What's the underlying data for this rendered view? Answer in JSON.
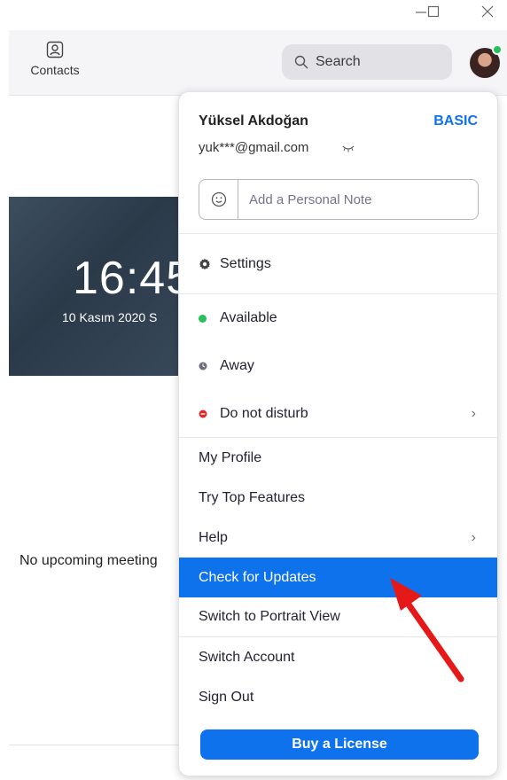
{
  "window": {
    "minimize_glyph": "—",
    "maximize_glyph": "☐",
    "close_glyph": "✕"
  },
  "toolbar": {
    "contacts_label": "Contacts",
    "search_label": "Search",
    "presence_color": "#26c15a"
  },
  "background": {
    "clock_time": "16:45",
    "clock_date": "10 Kasım 2020 S",
    "no_meetings": "No upcoming meeting"
  },
  "profile": {
    "name": "Yüksel Akdoğan",
    "plan": "BASIC",
    "email": "yuk***@gmail.com",
    "note_placeholder": "Add a Personal Note"
  },
  "menu": {
    "settings": "Settings",
    "available": "Available",
    "away": "Away",
    "do_not_disturb": "Do not disturb",
    "my_profile": "My Profile",
    "try_top_features": "Try Top Features",
    "help": "Help",
    "check_for_updates": "Check for Updates",
    "switch_portrait": "Switch to Portrait View",
    "switch_account": "Switch Account",
    "sign_out": "Sign Out",
    "buy_license": "Buy a License",
    "chevron": "›"
  },
  "colors": {
    "accent": "#0e72ed",
    "available": "#26c15a",
    "away": "#6e6e7a",
    "dnd": "#e02828",
    "annotation_arrow": "#e61919"
  }
}
